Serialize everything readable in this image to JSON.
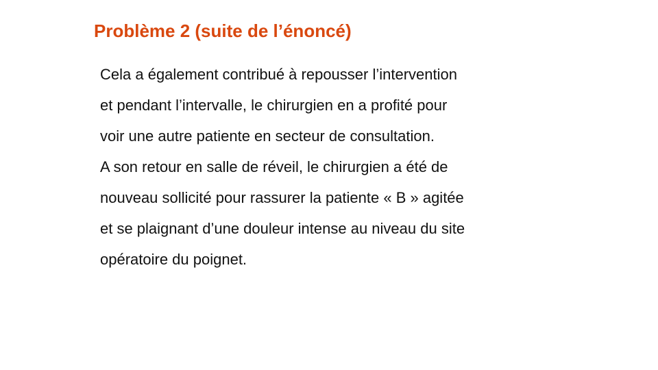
{
  "slide": {
    "title": "Problème 2 (suite de l’énoncé)",
    "title_color": "#D9480F",
    "body_lines": [
      "Cela a également contribué à repousser l’intervention",
      "et pendant l’intervalle,  le chirurgien en a profité pour",
      "voir une autre patiente en secteur de consultation.",
      "A son retour en salle de réveil, le chirurgien a été de",
      "nouveau sollicité pour rassurer la patiente « B » agitée",
      "et se plaignant d’une douleur intense au niveau du site",
      "opératoire du poignet."
    ]
  }
}
